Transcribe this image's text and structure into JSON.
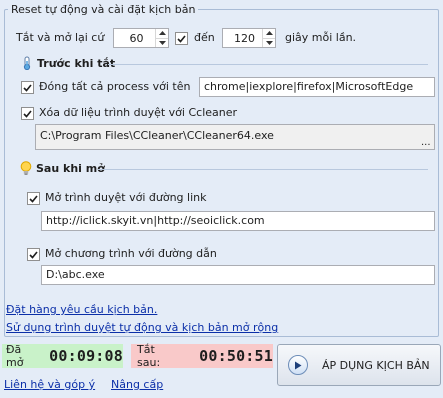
{
  "group": {
    "title": "Reset tự động và cài đặt kịch bản"
  },
  "reset_row": {
    "prefix": "Tắt và mở lại cứ",
    "from_value": "60",
    "from_label": "đến",
    "to_value": "120",
    "suffix": "giây mỗi lần.",
    "enabled": true
  },
  "before_close": {
    "title": "Trước khi tắt",
    "close_process": {
      "label": "Đóng tất cả process với tên",
      "checked": true,
      "value": "chrome|iexplore|firefox|MicrosoftEdge"
    },
    "clear_browser": {
      "label": "Xóa dữ liệu trình duyệt với Ccleaner",
      "checked": true,
      "path": "C:\\Program Files\\CCleaner\\CCleaner64.exe",
      "browse_label": "..."
    }
  },
  "after_open": {
    "title": "Sau khi mở",
    "open_browser": {
      "label": "Mở trình duyệt với đường link",
      "checked": true,
      "value": "http://iclick.skyit.vn|http://seoiclick.com"
    },
    "open_program": {
      "label": "Mở chương trình với đường dẫn",
      "checked": true,
      "value": "D:\\abc.exe"
    }
  },
  "links": {
    "order_script": "Đặt hàng yêu cầu kịch bản.",
    "use_auto_browser": "Sử dụng trình duyệt tự động và kịch bản mở rộng",
    "contact": "Liên hệ và góp ý",
    "upgrade": "Nâng cấp"
  },
  "timers": {
    "opened_label": "Đã mở",
    "opened_value": "00:09:08",
    "close_after_label": "Tắt sau:",
    "close_after_value": "00:50:51"
  },
  "apply_button": "ÁP DỤNG KỊCH BẢN",
  "colors": {
    "background": "#e4ecf7",
    "link": "#0b2fa8",
    "opened_bg": "#c9f2c9",
    "close_after_bg": "#f9c9c9"
  }
}
